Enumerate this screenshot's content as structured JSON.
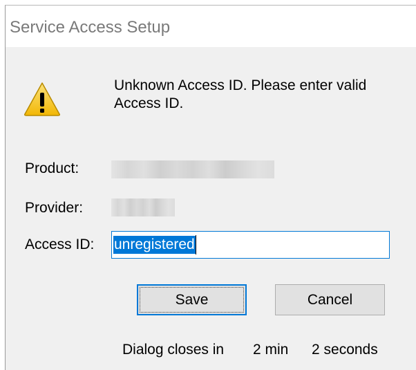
{
  "window": {
    "title": "Service Access Setup"
  },
  "message": {
    "text": "Unknown Access ID. Please enter valid Access ID.",
    "icon": "warning-icon"
  },
  "fields": {
    "product_label": "Product:",
    "provider_label": "Provider:",
    "access_id_label": "Access ID:",
    "access_id_value": "unregistered"
  },
  "buttons": {
    "save_label": "Save",
    "cancel_label": "Cancel"
  },
  "countdown": {
    "prefix": "Dialog closes in",
    "minutes": "2 min",
    "seconds": "2 seconds"
  },
  "colors": {
    "accent": "#0078d7",
    "warning_yellow": "#f5c623"
  }
}
